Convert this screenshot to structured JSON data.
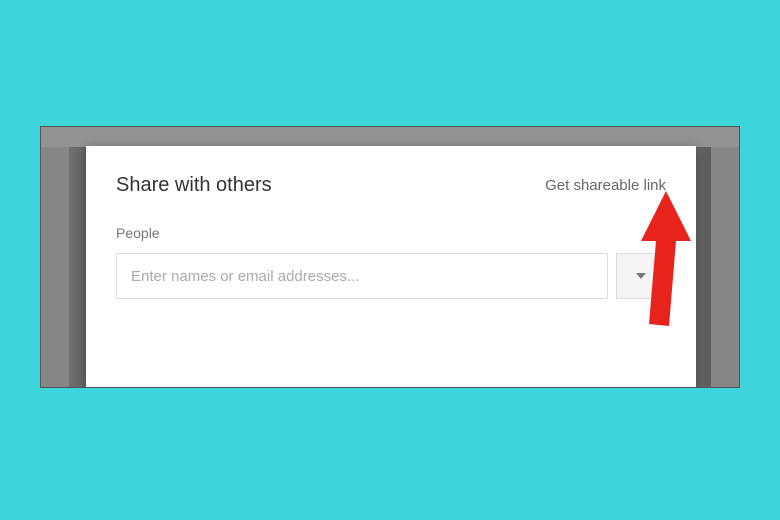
{
  "dialog": {
    "title": "Share with others",
    "shareable_link_label": "Get shareable link",
    "people_label": "People",
    "people_placeholder": "Enter names or email addresses..."
  },
  "annotation": {
    "arrow_color": "#e8231c"
  }
}
